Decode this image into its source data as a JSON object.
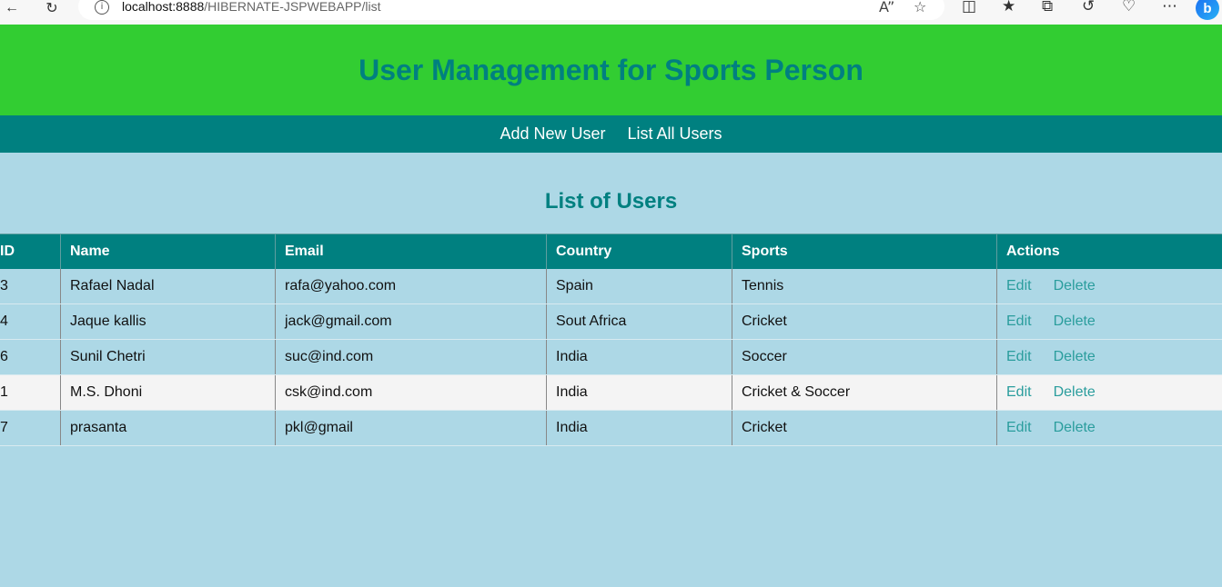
{
  "browser": {
    "url_host": "localhost:8888",
    "url_path": "/HIBERNATE-JSPWEBAPP/list",
    "read_aloud_label": "Ȃ"
  },
  "header": {
    "title": "User Management for Sports Person"
  },
  "nav": {
    "add_new_user": "Add New User",
    "list_all_users": "List All Users"
  },
  "main": {
    "title": "List of Users",
    "columns": [
      "ID",
      "Name",
      "Email",
      "Country",
      "Sports",
      "Actions"
    ],
    "rows": [
      {
        "id": "3",
        "name": "Rafael Nadal",
        "email": "rafa@yahoo.com",
        "country": "Spain",
        "sports": "Tennis",
        "edit": "Edit",
        "delete": "Delete"
      },
      {
        "id": "4",
        "name": "Jaque kallis",
        "email": "jack@gmail.com",
        "country": "Sout Africa",
        "sports": "Cricket",
        "edit": "Edit",
        "delete": "Delete"
      },
      {
        "id": "6",
        "name": "Sunil Chetri",
        "email": "suc@ind.com",
        "country": "India",
        "sports": "Soccer",
        "edit": "Edit",
        "delete": "Delete"
      },
      {
        "id": "1",
        "name": "M.S. Dhoni",
        "email": "csk@ind.com",
        "country": "India",
        "sports": "Cricket & Soccer",
        "edit": "Edit",
        "delete": "Delete"
      },
      {
        "id": "7",
        "name": "prasanta",
        "email": "pkl@gmail",
        "country": "India",
        "sports": "Cricket",
        "edit": "Edit",
        "delete": "Delete"
      }
    ]
  },
  "colors": {
    "header_bg": "#32cd32",
    "accent": "#008080",
    "page_bg": "#add8e6",
    "highlight_row_bg": "#f4f4f4"
  }
}
